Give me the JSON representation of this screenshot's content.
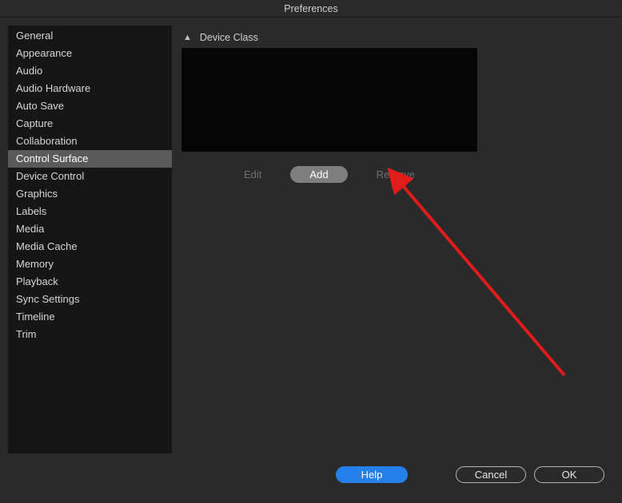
{
  "window": {
    "title": "Preferences"
  },
  "sidebar": {
    "items": [
      "General",
      "Appearance",
      "Audio",
      "Audio Hardware",
      "Auto Save",
      "Capture",
      "Collaboration",
      "Control Surface",
      "Device Control",
      "Graphics",
      "Labels",
      "Media",
      "Media Cache",
      "Memory",
      "Playback",
      "Sync Settings",
      "Timeline",
      "Trim"
    ],
    "selected_index": 7
  },
  "content": {
    "column_header": "Device Class",
    "edit_label": "Edit",
    "add_label": "Add",
    "remove_label": "Remove"
  },
  "footer": {
    "help_label": "Help",
    "cancel_label": "Cancel",
    "ok_label": "OK"
  },
  "annotation": {
    "arrow_color": "#e21b1b"
  }
}
